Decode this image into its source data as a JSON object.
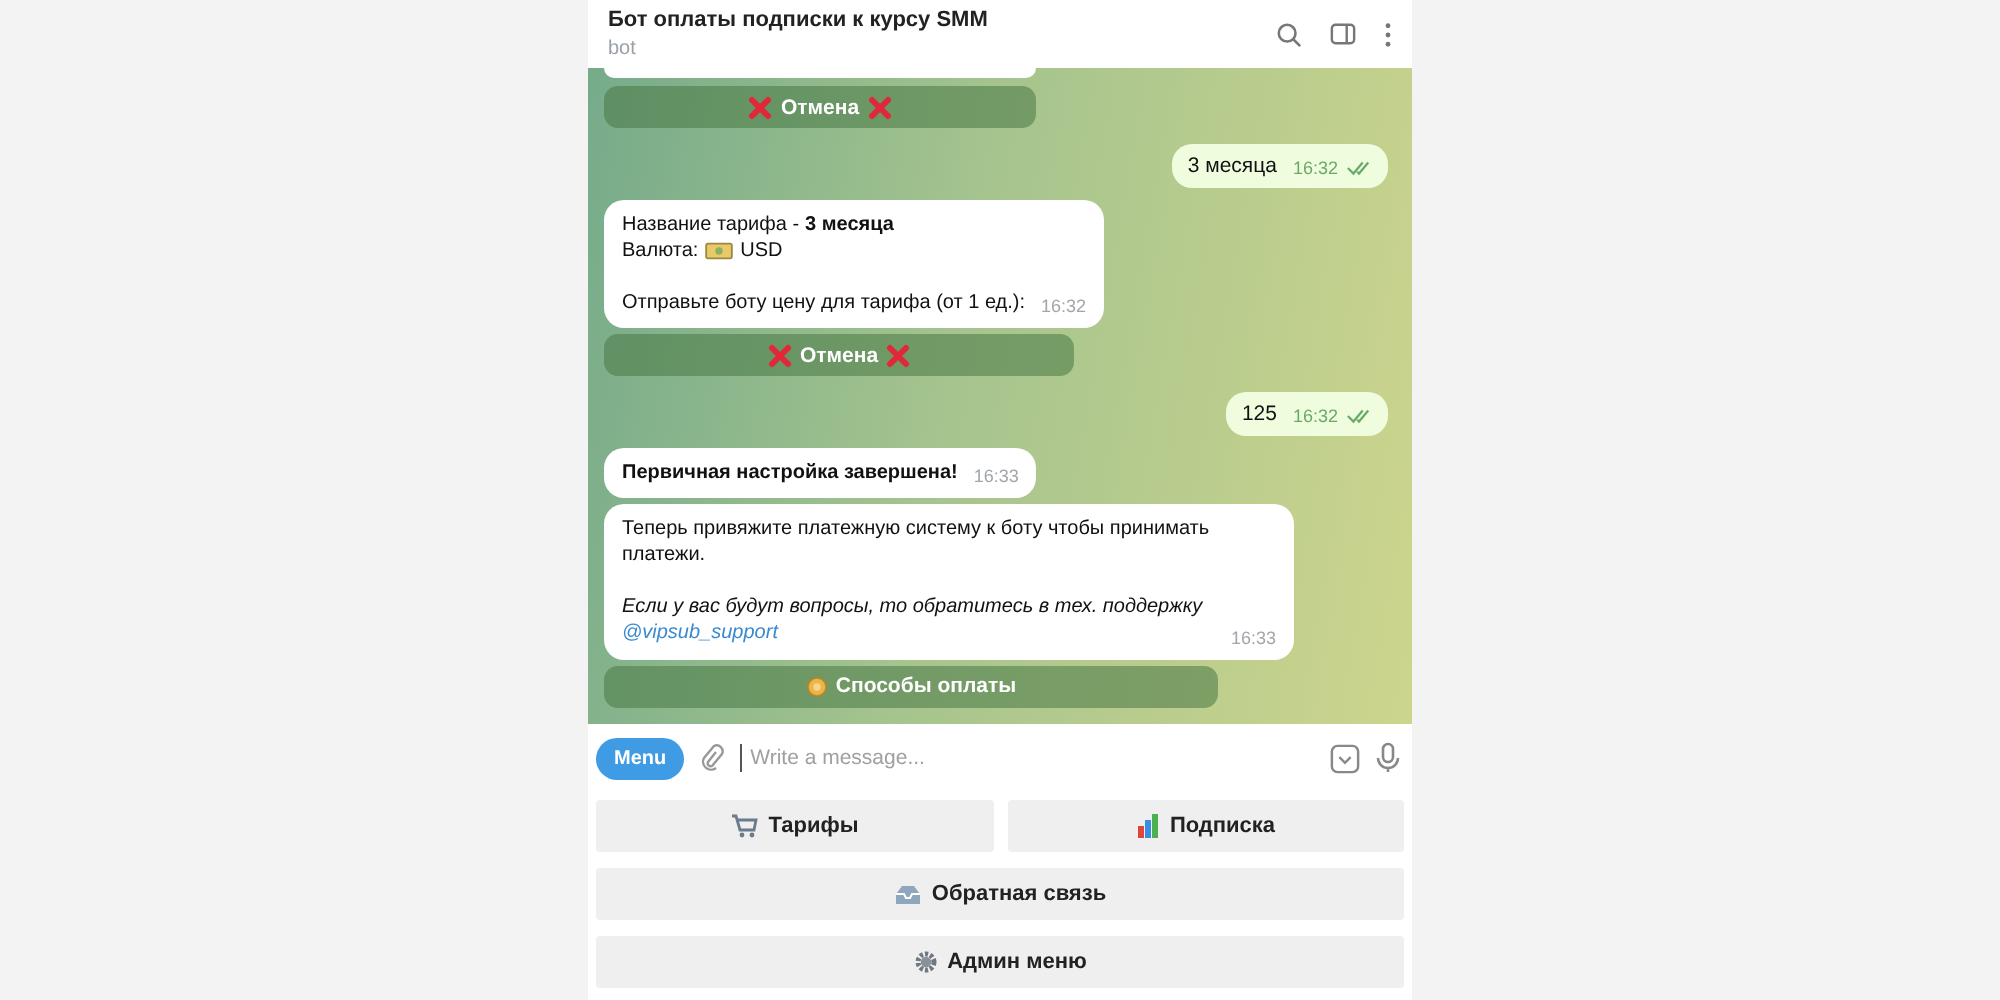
{
  "header": {
    "title": "Бот оплаты подписки к курсу SMM",
    "subtitle": "bot"
  },
  "messages": [
    {
      "kind": "cut_bubble"
    },
    {
      "kind": "cancel_button",
      "label": "Отмена"
    },
    {
      "kind": "outgoing",
      "text": "3 месяца",
      "time": "16:32",
      "read": true
    },
    {
      "kind": "incoming",
      "lines": [
        {
          "kind": "text",
          "text": "Название тарифа - **3 месяца**"
        },
        {
          "kind": "currency",
          "text": "Валюта:",
          "suffix": "USD"
        },
        {
          "kind": "blank"
        },
        {
          "kind": "text",
          "text": "Отправьте боту цену для тарифа (от 1 ед.):"
        }
      ],
      "time": "16:32"
    },
    {
      "kind": "cancel_button",
      "label": "Отмена"
    },
    {
      "kind": "outgoing",
      "text": "125",
      "time": "16:32",
      "read": true
    },
    {
      "kind": "incoming",
      "lines": [
        {
          "kind": "text",
          "text": "**Первичная настройка завершена!**"
        }
      ],
      "time": "16:33"
    },
    {
      "kind": "incoming",
      "lines": [
        {
          "kind": "text",
          "text": "Теперь привяжите платежную систему к боту чтобы принимать платежи."
        },
        {
          "kind": "blank"
        },
        {
          "kind": "text",
          "text": "*Если у вас будут вопросы, то обратитесь в тех. поддержку*"
        },
        {
          "kind": "link",
          "text": "@vipsub_support"
        }
      ],
      "time": "16:33"
    },
    {
      "kind": "payment_button",
      "label": "Способы оплаты"
    }
  ],
  "composer": {
    "menu_label": "Menu",
    "placeholder": "Write a message..."
  },
  "keyboard": [
    [
      {
        "label": "Тарифы"
      },
      {
        "label": "Подписка"
      }
    ],
    [
      {
        "label": "Обратная связь"
      }
    ],
    [
      {
        "label": "Админ меню"
      }
    ]
  ]
}
